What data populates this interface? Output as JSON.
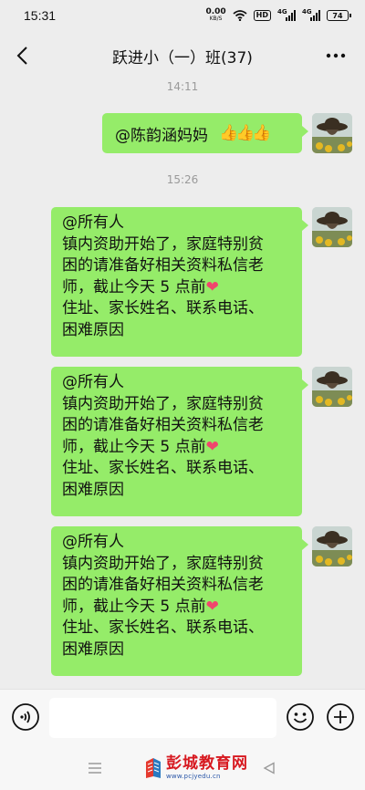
{
  "status_bar": {
    "time": "15:31",
    "net_speed_value": "0.00",
    "net_speed_unit": "KB/S",
    "hd_label": "HD",
    "signal1_tag": "4G",
    "signal2_tag": "4G",
    "battery": "74"
  },
  "header": {
    "title": "跃进小（一）班(37)"
  },
  "messages": [
    {
      "type": "timestamp",
      "text": "14:11"
    },
    {
      "type": "bubble",
      "mention": "@陈韵涵妈妈",
      "emoji": "👍👍👍"
    },
    {
      "type": "timestamp",
      "text": "15:26"
    },
    {
      "type": "bubble",
      "lines": [
        "@所有人",
        "镇内资助开始了，家庭特别贫",
        "困的请准备好相关资料私信老",
        "师，截止今天 5 点前",
        "住址、家长姓名、联系电话、",
        "困难原因"
      ],
      "heart": "❤"
    },
    {
      "type": "bubble",
      "lines": [
        "@所有人",
        "镇内资助开始了，家庭特别贫",
        "困的请准备好相关资料私信老",
        "师，截止今天 5 点前",
        "住址、家长姓名、联系电话、",
        "困难原因"
      ],
      "heart": "❤"
    },
    {
      "type": "bubble",
      "lines": [
        "@所有人",
        "镇内资助开始了，家庭特别贫",
        "困的请准备好相关资料私信老",
        "师，截止今天 5 点前",
        "住址、家长姓名、联系电话、",
        "困难原因"
      ],
      "heart": "❤"
    }
  ],
  "input_bar": {
    "text_value": ""
  },
  "icons": {
    "back": "back-chevron-icon",
    "more": "more-dots-icon",
    "voice": "voice-icon",
    "emoji": "emoji-icon",
    "plus": "plus-icon",
    "menu": "menu-icon",
    "system_back": "system-back-icon"
  },
  "watermark": {
    "main": "彭城教育网",
    "sub": "www.pcjyedu.cn"
  },
  "colors": {
    "bubble_green": "#95ec69",
    "background": "#ededed",
    "heart": "#f0466d"
  }
}
